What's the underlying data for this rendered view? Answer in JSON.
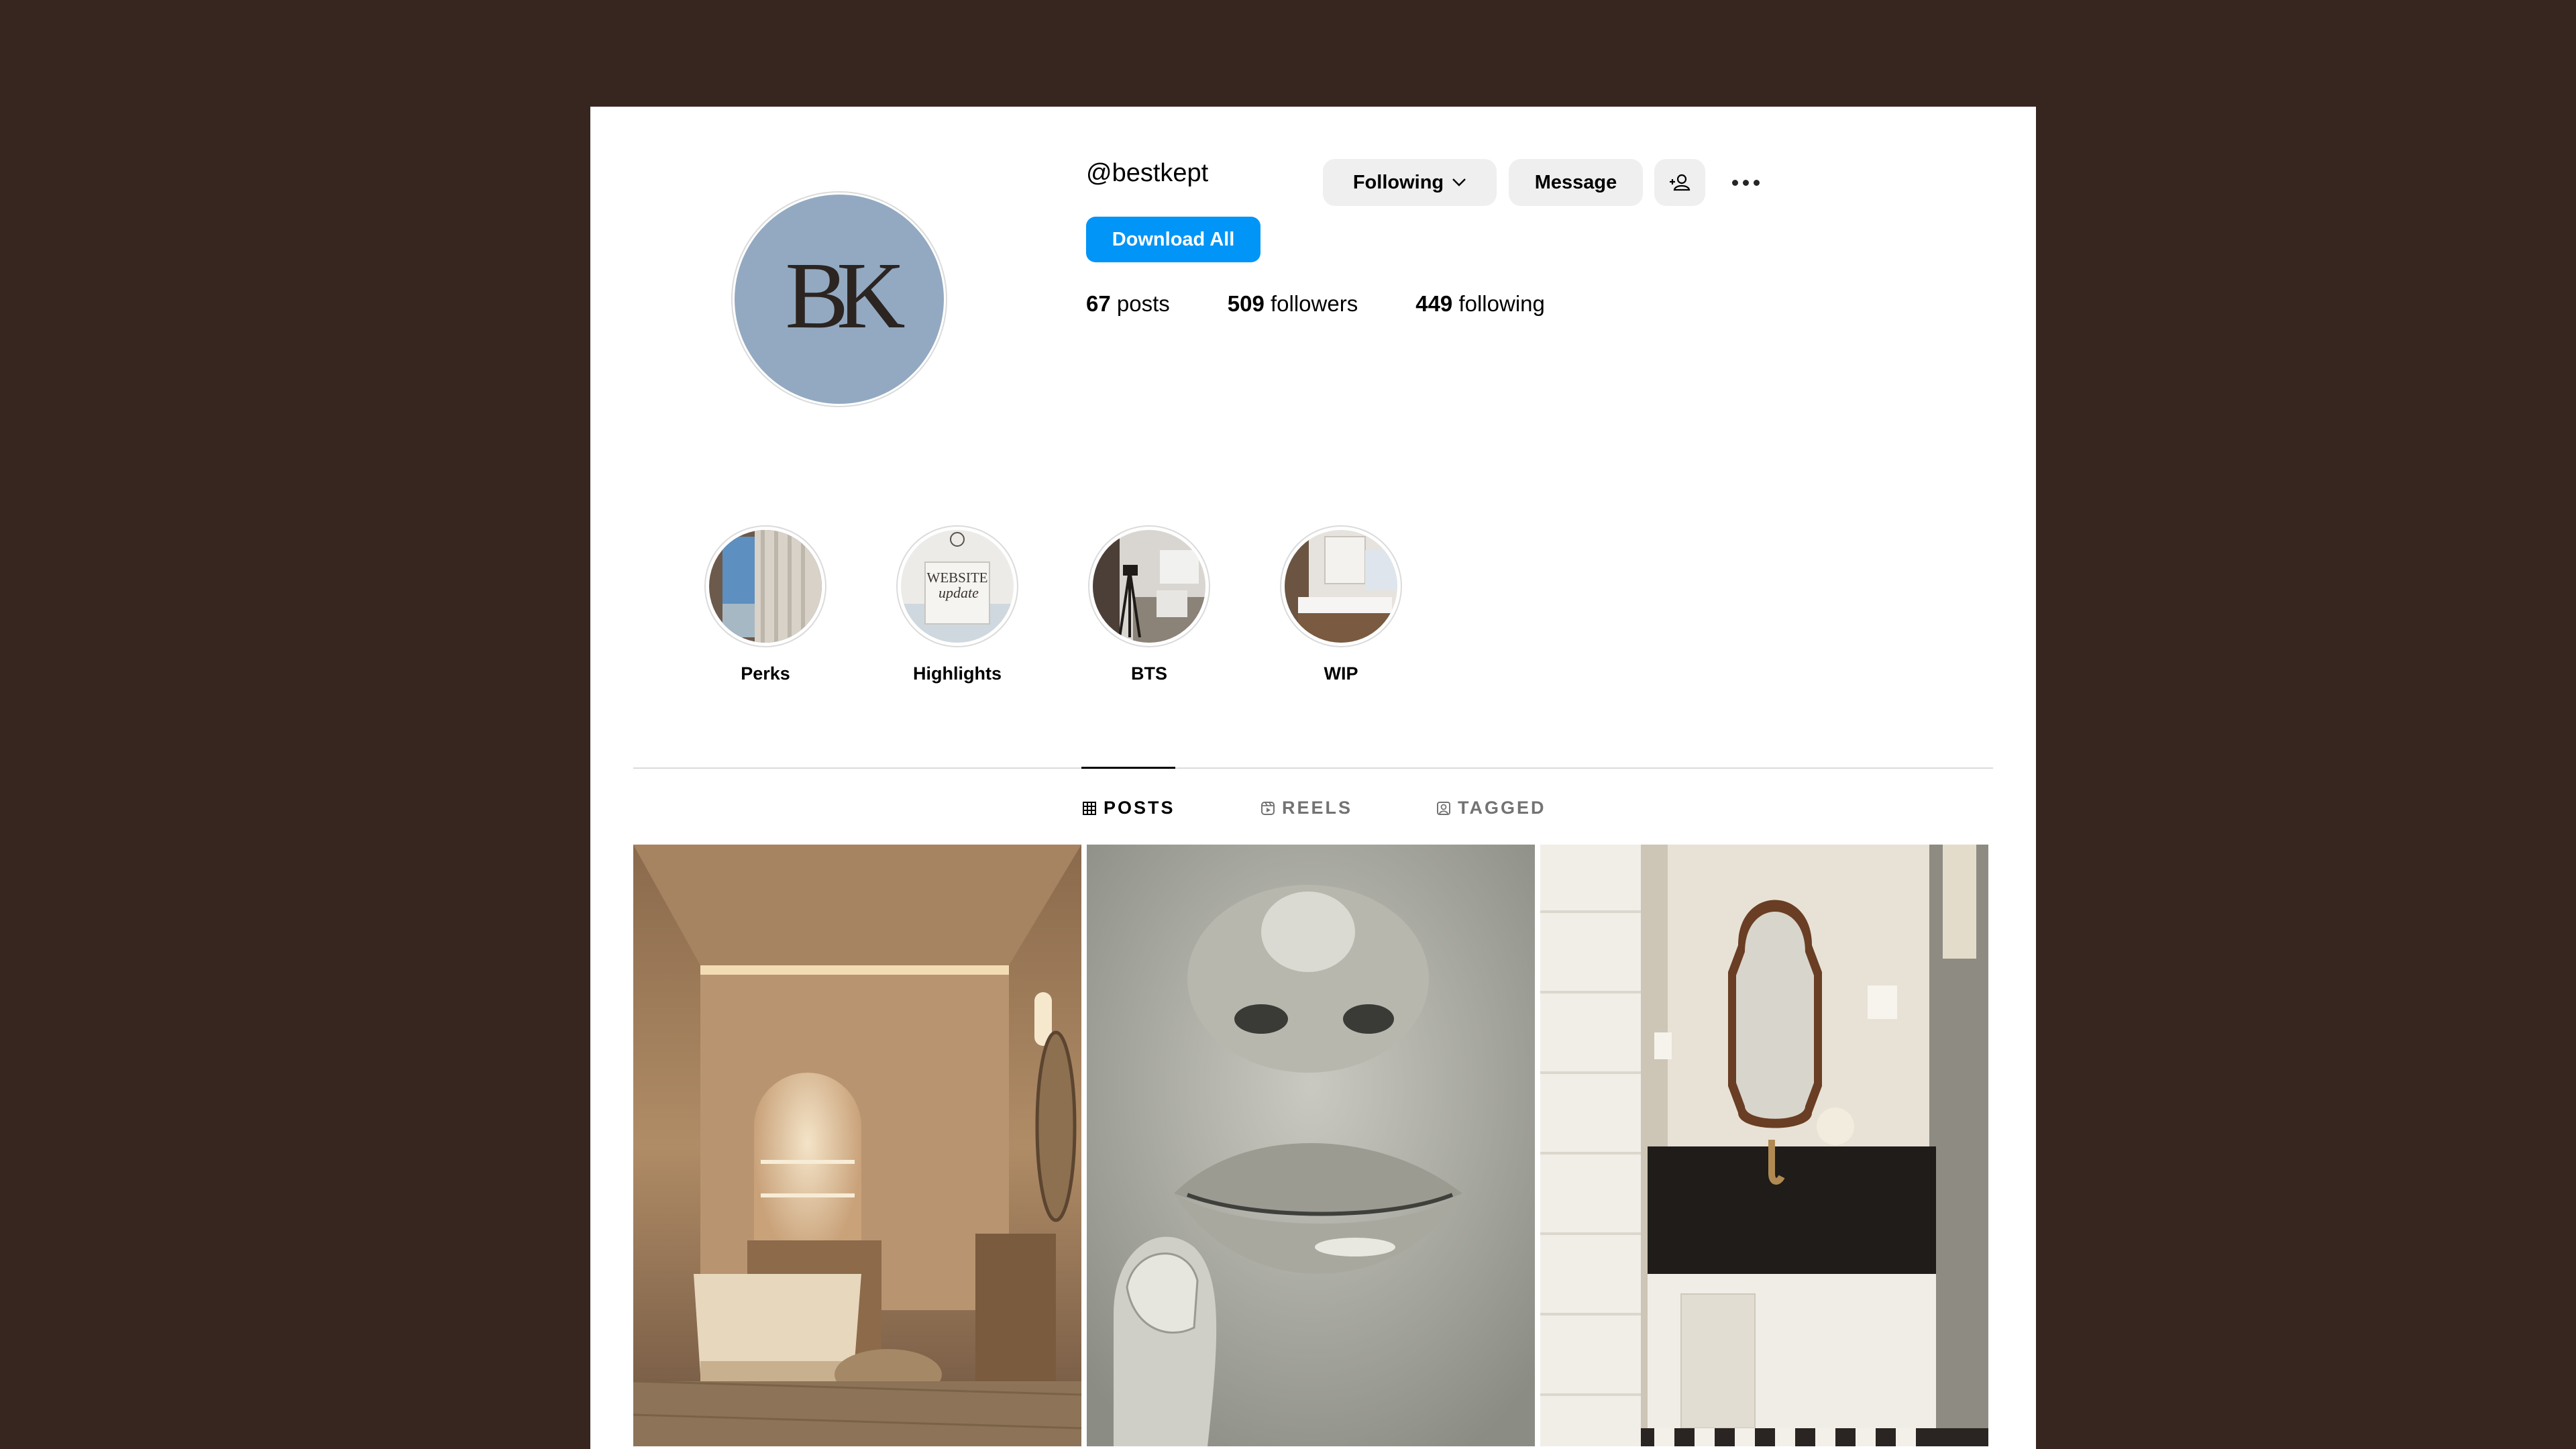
{
  "profile": {
    "username": "@bestkept",
    "avatar_monogram": "BK",
    "following_label": "Following",
    "message_label": "Message",
    "download_label": "Download All"
  },
  "stats": {
    "posts_count": "67",
    "posts_label": "posts",
    "followers_count": "509",
    "followers_label": "followers",
    "following_count": "449",
    "following_label": "following"
  },
  "highlights": [
    {
      "label": "Perks"
    },
    {
      "label": "Highlights",
      "thumb_text_1": "WEBSITE",
      "thumb_text_2": "update"
    },
    {
      "label": "BTS"
    },
    {
      "label": "WIP"
    }
  ],
  "tabs": [
    {
      "label": "POSTS",
      "icon": "grid-icon",
      "active": true
    },
    {
      "label": "REELS",
      "icon": "reels-icon",
      "active": false
    },
    {
      "label": "TAGGED",
      "icon": "tagged-icon",
      "active": false
    }
  ],
  "colors": {
    "background": "#372620",
    "avatar": "#93a9c1",
    "primary_button": "#0095f6",
    "secondary_button": "#efefef"
  }
}
